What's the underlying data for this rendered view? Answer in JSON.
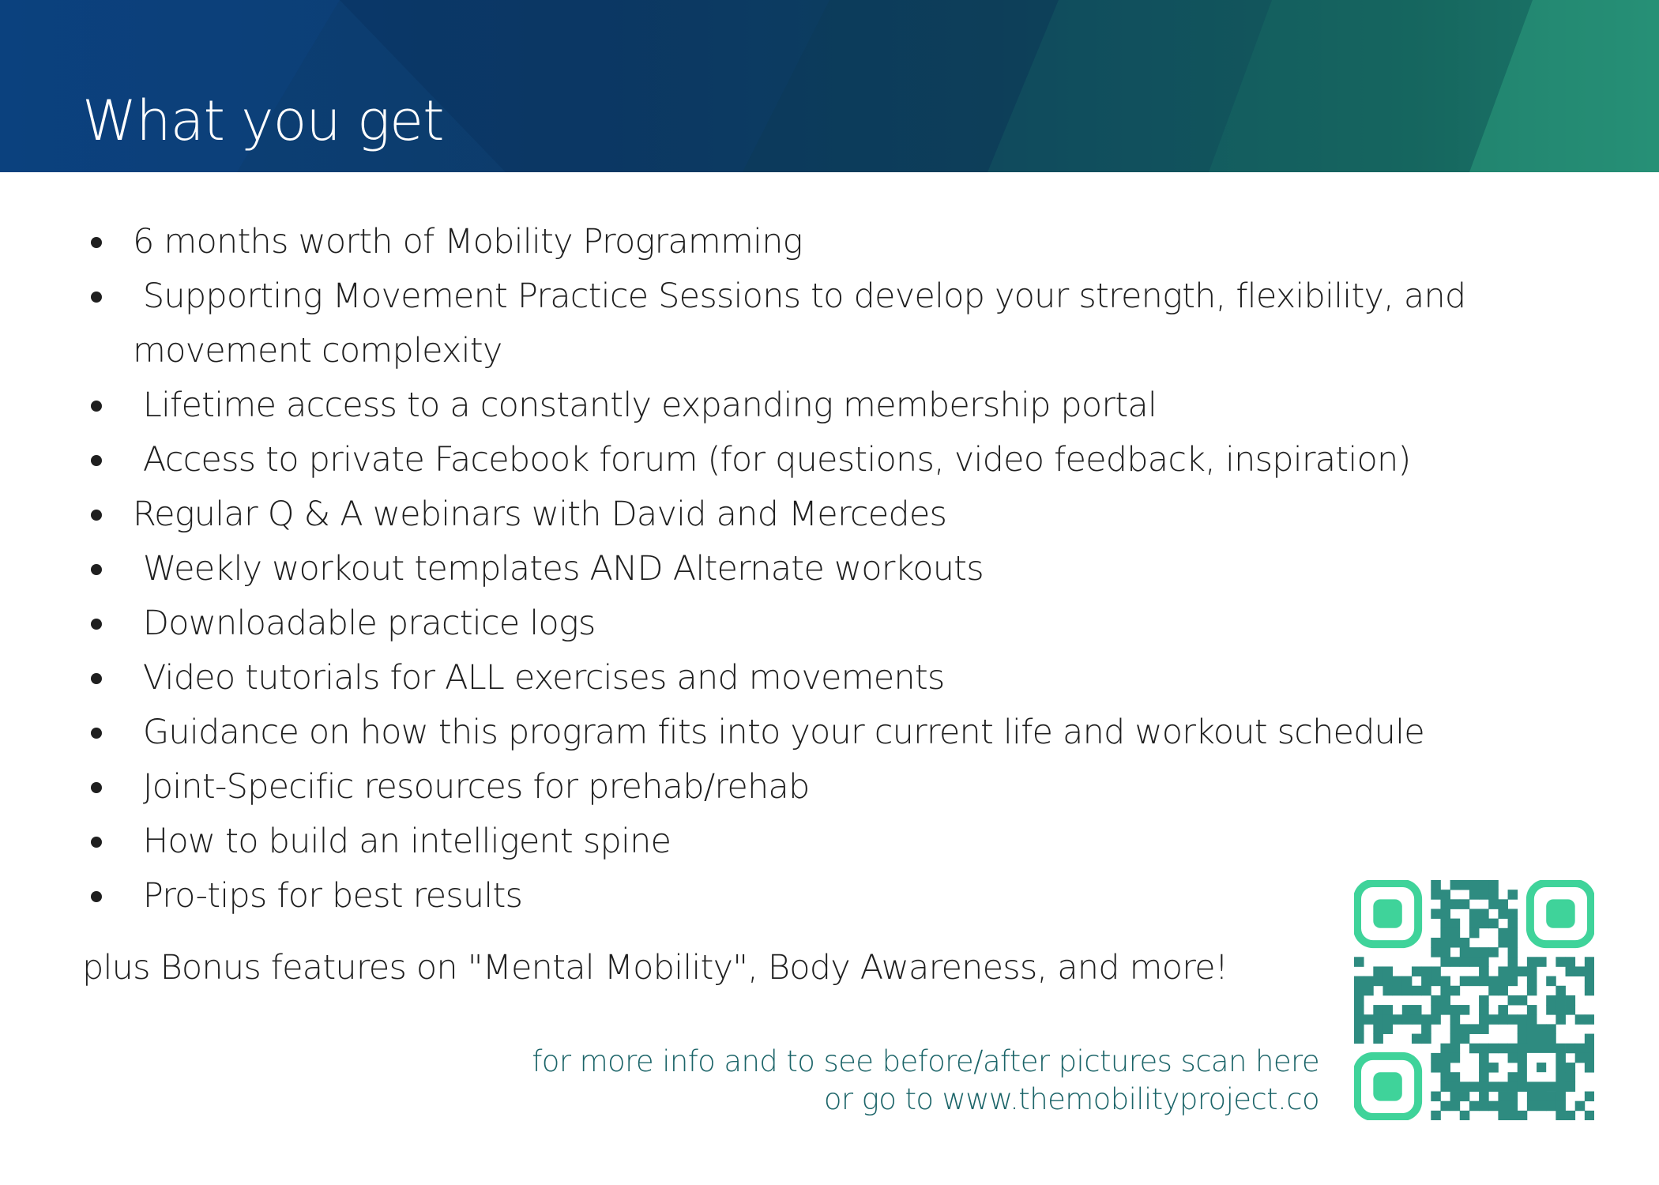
{
  "header": {
    "title": "What you get"
  },
  "features": [
    "6 months worth of Mobility Programming",
    " Supporting Movement Practice Sessions to develop your strength, flexibility, and movement complexity",
    " Lifetime access to a constantly expanding membership portal",
    " Access to private Facebook forum (for questions, video feedback, inspiration)",
    "Regular Q & A webinars with David and Mercedes",
    " Weekly workout templates AND Alternate workouts",
    " Downloadable practice logs",
    " Video tutorials for ALL exercises and movements",
    " Guidance on how this program fits into your current life and workout schedule",
    " Joint-Specific resources for prehab/rehab",
    " How to build an intelligent spine",
    " Pro-tips for best results"
  ],
  "bonus": "plus Bonus features on \"Mental Mobility\", Body Awareness, and more!",
  "footer": {
    "line1": "for more info and to see before/after pictures scan here",
    "line2": "or go to www.themobilityproject.co"
  },
  "colors": {
    "header_dark": "#0b3f7a",
    "header_teal": "#238a72",
    "footer_text": "#1b6468",
    "qr_green": "#3fd39a",
    "qr_teal": "#2e8b80",
    "body_text": "#1f1f1f"
  },
  "icons": {
    "qr": "qr-code-icon",
    "bullet": "bullet-dot-icon"
  }
}
